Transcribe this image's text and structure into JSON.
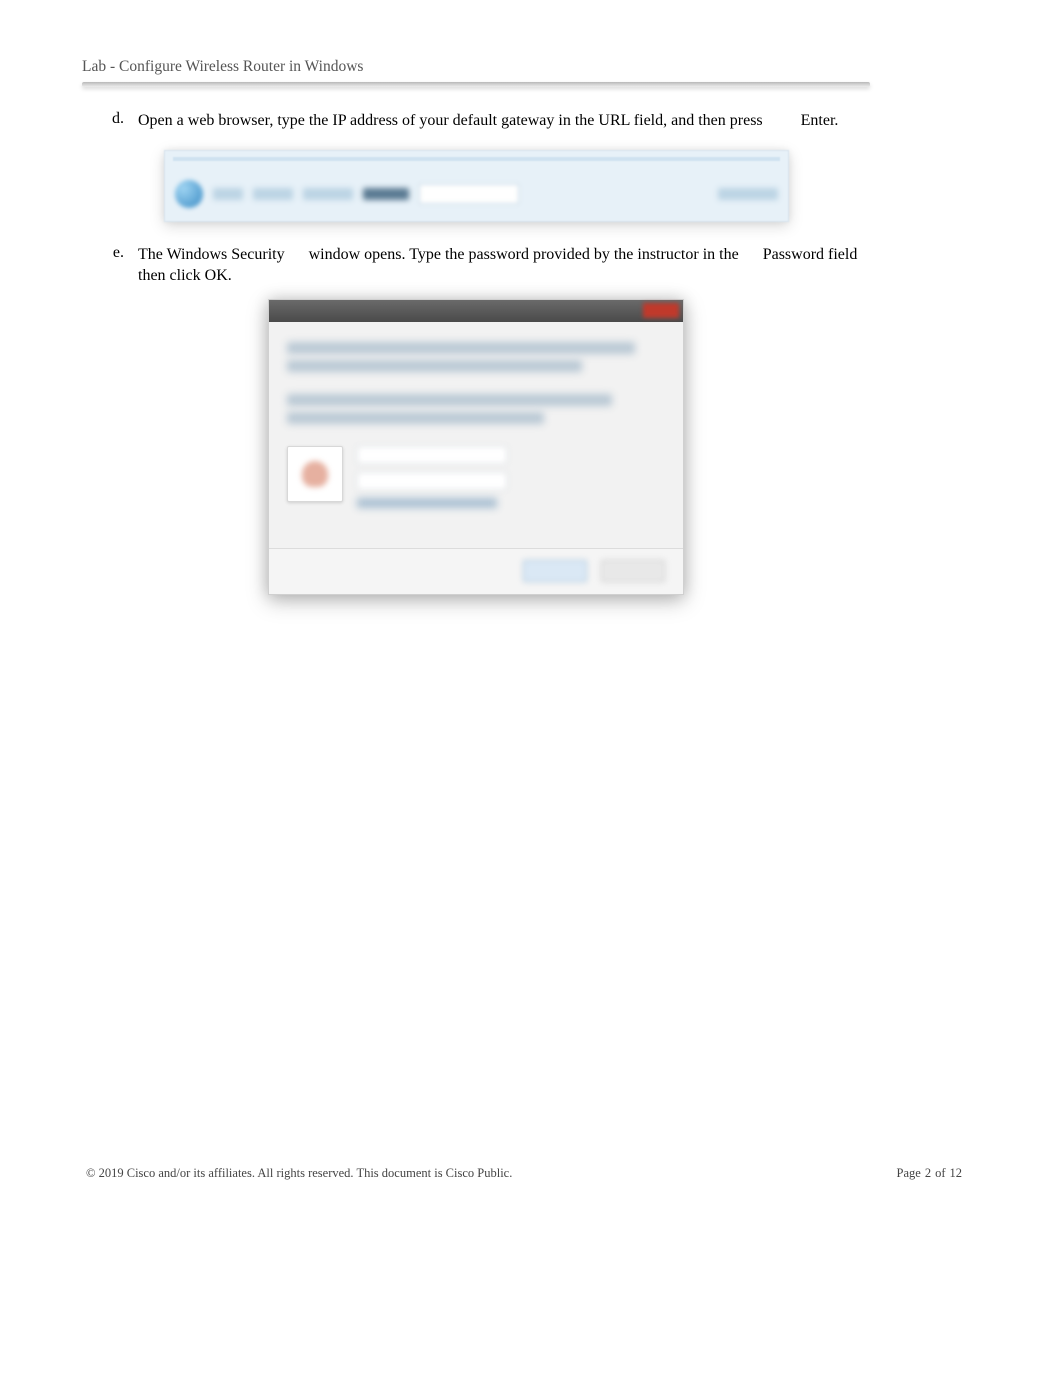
{
  "header": {
    "title": "Lab - Configure Wireless Router in Windows"
  },
  "steps": {
    "d": {
      "letter": "d.",
      "text_part1": "Open a web browser, type the IP address of your default gateway in the URL field, and then press",
      "key": "Enter",
      "period": "."
    },
    "e": {
      "letter": "e.",
      "text_part1": "The",
      "bold1": "Windows Security",
      "text_part2": "window opens. Type the password provided by the instructor in the",
      "bold2": "Password",
      "text_part3": "field then click",
      "bold3": "OK",
      "period": "."
    }
  },
  "footer": {
    "copyright": "© 2019 Cisco and/or its affiliates. All rights reserved. This document is Cisco Public.",
    "page_label": "Page",
    "page_current": "2",
    "page_of": "of",
    "page_total": "12"
  }
}
